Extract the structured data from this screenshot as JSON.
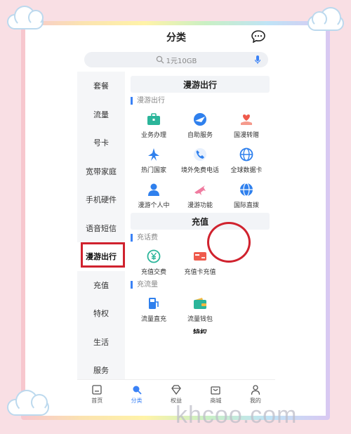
{
  "header": {
    "title": "分类"
  },
  "search": {
    "placeholder": "1元10GB"
  },
  "sidebar": {
    "items": [
      {
        "label": "套餐"
      },
      {
        "label": "流量"
      },
      {
        "label": "号卡"
      },
      {
        "label": "宽带家庭"
      },
      {
        "label": "手机硬件"
      },
      {
        "label": "语音短信"
      },
      {
        "label": "漫游出行"
      },
      {
        "label": "充值"
      },
      {
        "label": "特权"
      },
      {
        "label": "生活"
      },
      {
        "label": "服务"
      }
    ],
    "active_index": 6
  },
  "sections": {
    "roaming": {
      "title": "漫游出行",
      "subtitle": "漫游出行",
      "tiles": [
        {
          "label": "业务办理",
          "icon": "briefcase-icon"
        },
        {
          "label": "自助服务",
          "icon": "globe-plane-icon"
        },
        {
          "label": "国漫转赠",
          "icon": "heart-hand-icon"
        },
        {
          "label": "热门国家",
          "icon": "landmark-icon"
        },
        {
          "label": "境外免费电话",
          "icon": "phone-icon"
        },
        {
          "label": "全球数据卡",
          "icon": "globe-icon"
        },
        {
          "label": "漫游个人中",
          "icon": "person-icon"
        },
        {
          "label": "漫游功能",
          "icon": "airplane-icon"
        },
        {
          "label": "国际直拨",
          "icon": "world-icon"
        }
      ]
    },
    "recharge": {
      "title": "充值",
      "sub1": "充话费",
      "tiles1": [
        {
          "label": "充值交费",
          "icon": "yuan-coin-icon"
        },
        {
          "label": "充值卡充值",
          "icon": "card-icon"
        }
      ],
      "sub2": "充流量",
      "tiles2": [
        {
          "label": "流量直充",
          "icon": "fuel-icon"
        },
        {
          "label": "流量钱包",
          "icon": "wallet-icon"
        }
      ]
    },
    "next_title": "特权"
  },
  "tabbar": {
    "items": [
      {
        "label": "首页"
      },
      {
        "label": "分类"
      },
      {
        "label": "权益"
      },
      {
        "label": "商城"
      },
      {
        "label": "我的"
      }
    ],
    "active_index": 1
  },
  "watermark": "khcoo.com",
  "colors": {
    "accent": "#3b82f6",
    "highlight": "#d0222e"
  }
}
